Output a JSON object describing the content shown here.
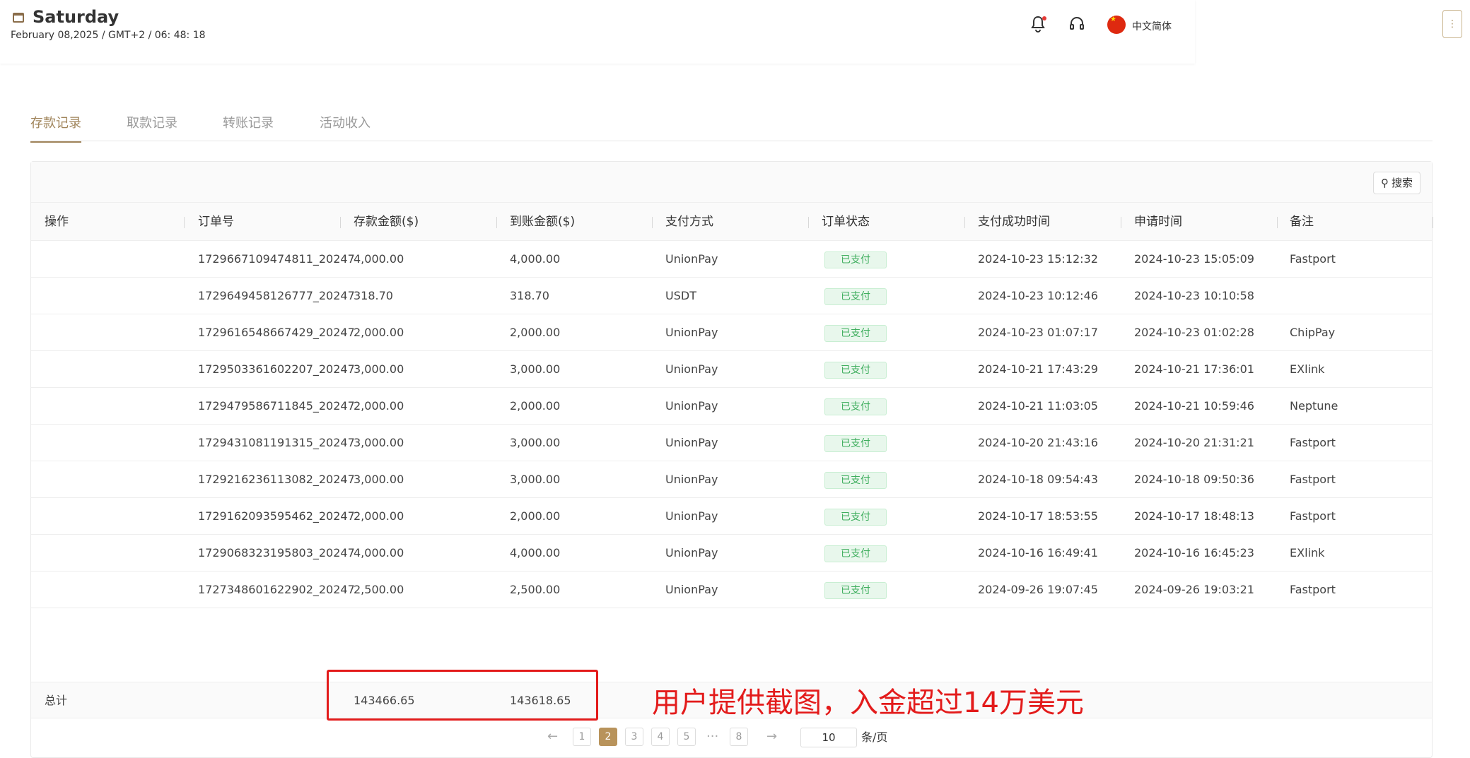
{
  "header": {
    "day": "Saturday",
    "datetime": "February 08,2025 / GMT+2 / 06: 48: 18",
    "language": "中文简体",
    "bell_icon": "bell-icon",
    "support_icon": "headset-icon"
  },
  "tabs": [
    {
      "label": "存款记录",
      "active": true
    },
    {
      "label": "取款记录",
      "active": false
    },
    {
      "label": "转账记录",
      "active": false
    },
    {
      "label": "活动收入",
      "active": false
    }
  ],
  "toolbar": {
    "search_label": "搜索"
  },
  "table": {
    "columns": [
      "操作",
      "订单号",
      "存款金额($)",
      "到账金额($)",
      "支付方式",
      "订单状态",
      "支付成功时间",
      "申请时间",
      "备注"
    ],
    "rows": [
      {
        "order": "1729667109474811_20247",
        "deposit": "4,000.00",
        "received": "4,000.00",
        "method": "UnionPay",
        "status": "已支付",
        "paid_time": "2024-10-23 15:12:32",
        "apply_time": "2024-10-23 15:05:09",
        "note": "Fastport"
      },
      {
        "order": "1729649458126777_20247",
        "deposit": "318.70",
        "received": "318.70",
        "method": "USDT",
        "status": "已支付",
        "paid_time": "2024-10-23 10:12:46",
        "apply_time": "2024-10-23 10:10:58",
        "note": ""
      },
      {
        "order": "1729616548667429_20247",
        "deposit": "2,000.00",
        "received": "2,000.00",
        "method": "UnionPay",
        "status": "已支付",
        "paid_time": "2024-10-23 01:07:17",
        "apply_time": "2024-10-23 01:02:28",
        "note": "ChipPay"
      },
      {
        "order": "1729503361602207_20247",
        "deposit": "3,000.00",
        "received": "3,000.00",
        "method": "UnionPay",
        "status": "已支付",
        "paid_time": "2024-10-21 17:43:29",
        "apply_time": "2024-10-21 17:36:01",
        "note": "EXlink"
      },
      {
        "order": "1729479586711845_20247",
        "deposit": "2,000.00",
        "received": "2,000.00",
        "method": "UnionPay",
        "status": "已支付",
        "paid_time": "2024-10-21 11:03:05",
        "apply_time": "2024-10-21 10:59:46",
        "note": "Neptune"
      },
      {
        "order": "1729431081191315_20247",
        "deposit": "3,000.00",
        "received": "3,000.00",
        "method": "UnionPay",
        "status": "已支付",
        "paid_time": "2024-10-20 21:43:16",
        "apply_time": "2024-10-20 21:31:21",
        "note": "Fastport"
      },
      {
        "order": "1729216236113082_20247",
        "deposit": "3,000.00",
        "received": "3,000.00",
        "method": "UnionPay",
        "status": "已支付",
        "paid_time": "2024-10-18 09:54:43",
        "apply_time": "2024-10-18 09:50:36",
        "note": "Fastport"
      },
      {
        "order": "1729162093595462_20247",
        "deposit": "2,000.00",
        "received": "2,000.00",
        "method": "UnionPay",
        "status": "已支付",
        "paid_time": "2024-10-17 18:53:55",
        "apply_time": "2024-10-17 18:48:13",
        "note": "Fastport"
      },
      {
        "order": "1729068323195803_20247",
        "deposit": "4,000.00",
        "received": "4,000.00",
        "method": "UnionPay",
        "status": "已支付",
        "paid_time": "2024-10-16 16:49:41",
        "apply_time": "2024-10-16 16:45:23",
        "note": "EXlink"
      },
      {
        "order": "1727348601622902_20247",
        "deposit": "2,500.00",
        "received": "2,500.00",
        "method": "UnionPay",
        "status": "已支付",
        "paid_time": "2024-09-26 19:07:45",
        "apply_time": "2024-09-26 19:03:21",
        "note": "Fastport"
      }
    ],
    "total": {
      "label": "总计",
      "deposit": "143466.65",
      "received": "143618.65"
    }
  },
  "annotation": "用户提供截图，入金超过14万美元",
  "pagination": {
    "prev": "←",
    "next": "→",
    "pages": [
      "1",
      "2",
      "3",
      "4",
      "5",
      "···",
      "8"
    ],
    "current": "2",
    "page_size": "10",
    "unit": "条/页"
  },
  "colors": {
    "accent": "#a0845a",
    "status_green": "#3fae5e",
    "annotation_red": "#e31b1b"
  }
}
